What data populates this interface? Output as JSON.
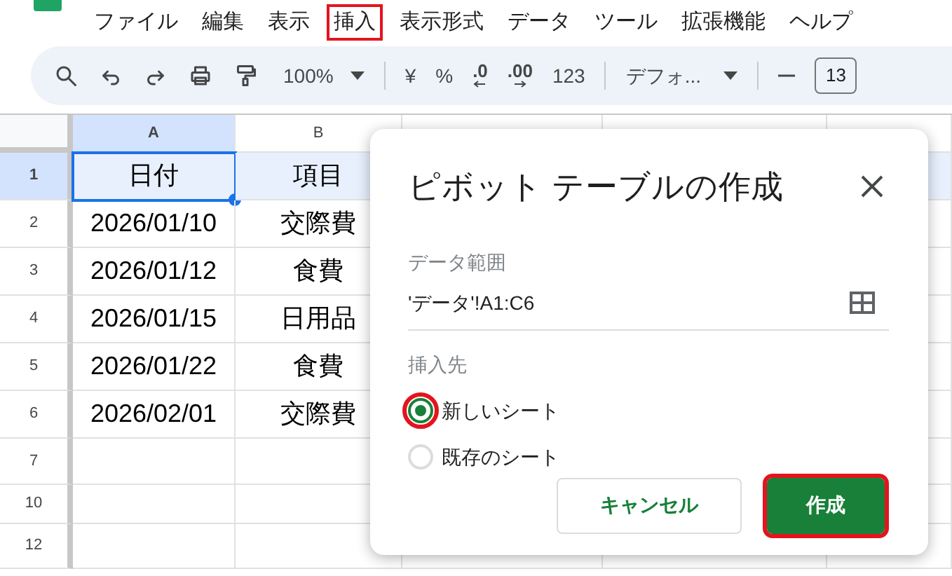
{
  "menu": [
    {
      "label": "ファイル",
      "highlighted": false
    },
    {
      "label": "編集",
      "highlighted": false
    },
    {
      "label": "表示",
      "highlighted": false
    },
    {
      "label": "挿入",
      "highlighted": true
    },
    {
      "label": "表示形式",
      "highlighted": false
    },
    {
      "label": "データ",
      "highlighted": false
    },
    {
      "label": "ツール",
      "highlighted": false
    },
    {
      "label": "拡張機能",
      "highlighted": false
    },
    {
      "label": "ヘルプ",
      "highlighted": false
    }
  ],
  "toolbar": {
    "zoom": "100%",
    "currency": "¥",
    "percent": "%",
    "decrease_decimal": ".0",
    "increase_decimal": ".00",
    "number_format": "123",
    "font": "デフォ...",
    "font_size": "13"
  },
  "sheet": {
    "columns": [
      {
        "label": "A",
        "selected": true
      },
      {
        "label": "B",
        "selected": false
      }
    ],
    "rows": [
      {
        "number": "1",
        "selected": true,
        "cells": [
          {
            "text": "日付",
            "selected": true
          },
          {
            "text": "項目",
            "selected": false
          }
        ]
      },
      {
        "number": "2",
        "selected": false,
        "cells": [
          {
            "text": "2026/01/10",
            "selected": false
          },
          {
            "text": "交際費",
            "selected": false
          }
        ]
      },
      {
        "number": "3",
        "selected": false,
        "cells": [
          {
            "text": "2026/01/12",
            "selected": false
          },
          {
            "text": "食費",
            "selected": false
          }
        ]
      },
      {
        "number": "4",
        "selected": false,
        "cells": [
          {
            "text": "2026/01/15",
            "selected": false
          },
          {
            "text": "日用品",
            "selected": false
          }
        ]
      },
      {
        "number": "5",
        "selected": false,
        "cells": [
          {
            "text": "2026/01/22",
            "selected": false
          },
          {
            "text": "食費",
            "selected": false
          }
        ]
      },
      {
        "number": "6",
        "selected": false,
        "cells": [
          {
            "text": "2026/02/01",
            "selected": false
          },
          {
            "text": "交際費",
            "selected": false
          }
        ]
      },
      {
        "number": "7",
        "selected": false,
        "cells": []
      },
      {
        "number": "10",
        "selected": false,
        "cells": []
      },
      {
        "number": "12",
        "selected": false,
        "cells": []
      }
    ]
  },
  "dialog": {
    "title": "ピボット テーブルの作成",
    "range_label": "データ範囲",
    "range_value": "'データ'!A1:C6",
    "destination_label": "挿入先",
    "options": [
      {
        "label": "新しいシート",
        "selected": true,
        "highlighted": true
      },
      {
        "label": "既存のシート",
        "selected": false,
        "highlighted": false
      }
    ],
    "buttons": [
      {
        "label": "キャンセル",
        "kind": "secondary",
        "highlighted": false
      },
      {
        "label": "作成",
        "kind": "primary",
        "highlighted": true
      }
    ]
  }
}
